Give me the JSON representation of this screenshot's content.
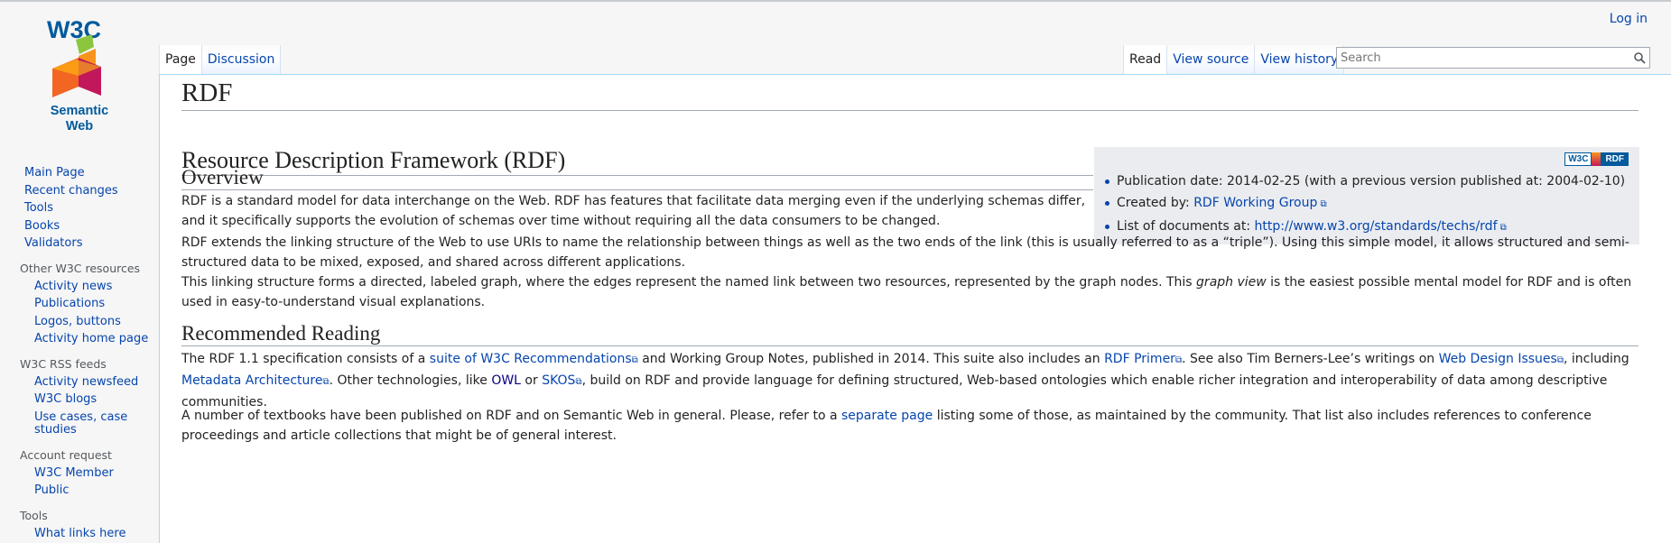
{
  "personal": {
    "login": "Log in"
  },
  "logo": {
    "text_line1": "W3C",
    "text_line2": "Semantic",
    "text_line3": "Web"
  },
  "tabs": {
    "left": [
      {
        "label": "Page",
        "selected": true
      },
      {
        "label": "Discussion",
        "selected": false
      }
    ],
    "right": [
      {
        "label": "Read",
        "selected": true
      },
      {
        "label": "View source",
        "selected": false
      },
      {
        "label": "View history",
        "selected": false
      }
    ]
  },
  "search": {
    "placeholder": "Search",
    "icon": "search-icon"
  },
  "sidebar": {
    "main": [
      "Main Page",
      "Recent changes",
      "Tools",
      "Books",
      "Validators"
    ],
    "portals": [
      {
        "heading": "Other W3C resources",
        "items": [
          "Activity news",
          "Publications",
          "Logos, buttons",
          "Activity home page"
        ]
      },
      {
        "heading": "W3C RSS feeds",
        "items": [
          "Activity newsfeed",
          "W3C blogs",
          "Use cases, case studies"
        ]
      },
      {
        "heading": "Account request",
        "items": [
          "W3C Member",
          "Public"
        ]
      },
      {
        "heading": "Tools",
        "items": [
          "What links here"
        ]
      }
    ]
  },
  "page": {
    "title": "RDF",
    "heading": "Resource Description Framework (RDF)",
    "overview": {
      "heading": "Overview",
      "p1_line1": "RDF is a standard model for data interchange on the Web. RDF has features that facilitate data merging even if the underlying schemas differ,",
      "p1_line2": "and it specifically supports the evolution of schemas over time without requiring all the data consumers to be changed.",
      "p2": "RDF extends the linking structure of the Web to use URIs to name the relationship between things as well as the two ends of the link (this is usually referred to as a “triple”). Using this simple model, it allows structured and semi-structured data to be mixed, exposed, and shared across different applications.",
      "p3_a": "This linking structure forms a directed, labeled graph, where the edges represent the named link between two resources, represented by the graph nodes. This ",
      "p3_em": "graph view",
      "p3_b": " is the easiest possible mental model for RDF and is often used in easy-to-understand visual explanations."
    },
    "reading": {
      "heading": "Recommended Reading",
      "p1_a": "The RDF 1.1 specification consists of a ",
      "p1_link1": "suite of W3C Recommendations",
      "p1_b": " and Working Group Notes, published in 2014. This suite also includes an ",
      "p1_link2": "RDF Primer",
      "p1_c": ". See also Tim Berners-Lee’s writings on ",
      "p1_link3": "Web Design Issues",
      "p1_d": ", including ",
      "p1_link4": "Metadata Architecture",
      "p1_e": ". Other technologies, like ",
      "p1_link5": "OWL",
      "p1_f": " or ",
      "p1_link6": "SKOS",
      "p1_g": ", build on RDF and provide language for defining structured, Web-based ontologies which enable richer integration and interoperability of data among descriptive communities.",
      "p2_a": "A number of textbooks have been published on RDF and on Semantic Web in general. Please, refer to a ",
      "p2_link": "separate page",
      "p2_b": " listing some of those, as maintained by the community. That list also includes references to conference proceedings and article collections that might be of general interest."
    },
    "infobox": {
      "badge_left": "W3C",
      "badge_right": "RDF",
      "pub_label": "Publication date: 2014-02-25 (with a previous version published at: 2004-02-10)",
      "created_label": "Created by: ",
      "created_link": "RDF Working Group",
      "docs_label": "List of documents at: ",
      "docs_link": "http://www.w3.org/standards/techs/rdf"
    }
  },
  "colors": {
    "link": "#0645ad",
    "border": "#a2a9b1",
    "infobox_bg": "#eaecf0"
  }
}
